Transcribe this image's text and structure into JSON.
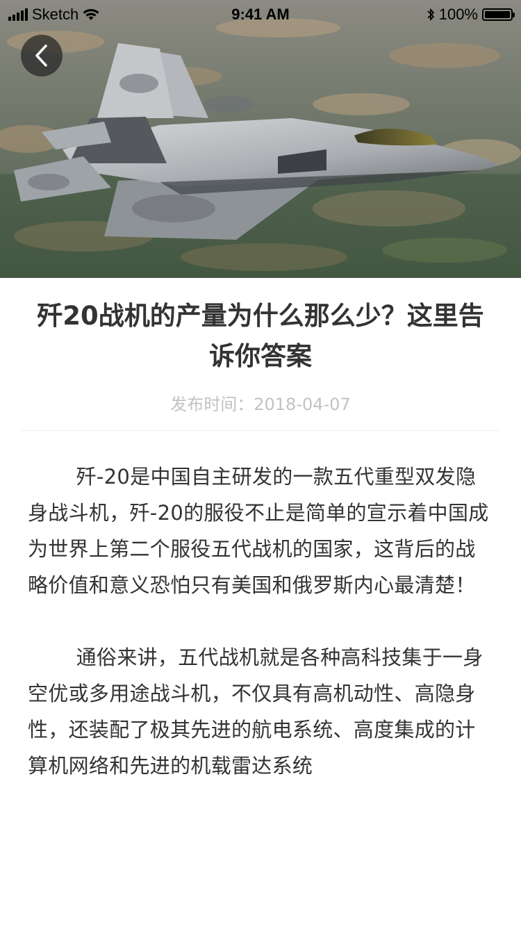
{
  "status_bar": {
    "carrier": "Sketch",
    "time": "9:41 AM",
    "battery_text": "100%",
    "battery_level": 1.0
  },
  "hero": {
    "image": "fighter-jet-photo"
  },
  "back_button": {
    "icon": "chevron-left-icon"
  },
  "article": {
    "title": "歼20战机的产量为什么那么少？这里告诉你答案",
    "publish_time": "发布时间：2018-04-07",
    "paragraphs": [
      "歼-20是中国自主研发的一款五代重型双发隐身战斗机，歼-20的服役不止是简单的宣示着中国成为世界上第二个服役五代战机的国家，这背后的战略价值和意义恐怕只有美国和俄罗斯内心最清楚！",
      "通俗来讲，五代战机就是各种高科技集于一身空优或多用途战斗机，不仅具有高机动性、高隐身性，还装配了极其先进的航电系统、高度集成的计算机网络和先进的机载雷达系统"
    ]
  },
  "colors": {
    "title": "#333333",
    "meta": "#c2c2c2",
    "divider": "#eeeeee",
    "body": "#333333"
  }
}
